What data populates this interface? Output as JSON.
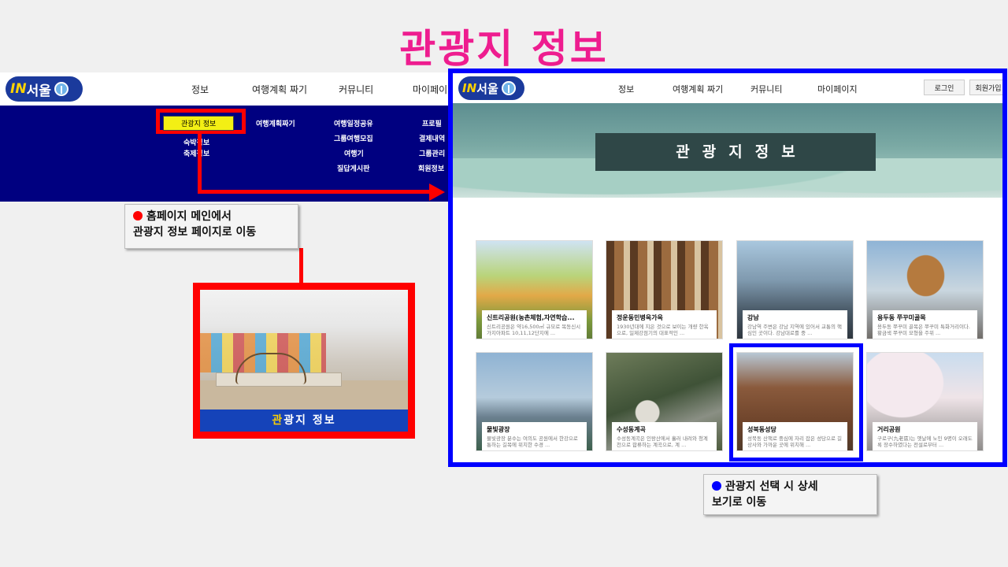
{
  "slide_title": "관광지 정보",
  "brand": {
    "prefix": "IN",
    "name": "서울"
  },
  "left_page": {
    "nav": [
      "정보",
      "여행계획 짜기",
      "커뮤니티",
      "마이페이지"
    ],
    "menu": {
      "col1": [
        "관광지 정보",
        "숙박정보",
        "축제정보"
      ],
      "col2": [
        "여행계획짜기"
      ],
      "col3": [
        "여행일정공유",
        "그룹여행모집",
        "여행기",
        "질답게시판"
      ],
      "col4": [
        "프로필",
        "결제내역",
        "그룹관리",
        "회원정보"
      ]
    },
    "highlighted_item": "관광지 정보"
  },
  "callout_left": {
    "line1": "홈페이지 메인에서",
    "line2": "관광지 정보 페이지로 이동"
  },
  "thumbnail_caption": {
    "first": "관",
    "rest": "광지 정보"
  },
  "right_page": {
    "nav": [
      "정보",
      "여행계획 짜기",
      "커뮤니티",
      "마이페이지"
    ],
    "login": "로그인",
    "signup": "회원가입",
    "hero_title": "관광지정보",
    "cards": [
      {
        "title": "신트리공원(농촌체험,자연학습...",
        "desc": "신트리공원은 약16,500㎡ 규모로 목동신시가지아파트 10,11,12단지에 ..."
      },
      {
        "title": "정운동민병옥가옥",
        "desc": "1930년대에 지은 것으로 보이는 개량 한옥으로, 일제강점기의 대표적인 ..."
      },
      {
        "title": "강남",
        "desc": "강남역 주변은 강남 지역에 있어서 교통의 핵심인 곳이다. 강남대로를 중 ..."
      },
      {
        "title": "용두동 쭈꾸미골목",
        "desc": "용두동 쭈꾸미 골목은 쭈꾸미 특화거리이다. 황금색 쭈꾸미 모형을 주위 ..."
      },
      {
        "title": "물빛광장",
        "desc": "물빛광장 분수는 여의도 공원에서 한강으로 통하는 길목에 위치한 수경 ..."
      },
      {
        "title": "수성동계곡",
        "desc": "수성동계곡은 인왕산에서 흘러 내려와 청계천으로 합류하는 계곡으로, 계 ..."
      },
      {
        "title": "성북동성당",
        "desc": "성북동 산책로 중심에 자리 잡은 성당으로 길상사와 가까운 곳에 위치해 ..."
      },
      {
        "title": "거리공원",
        "desc": "구로구(九老區)는 옛날에 노인 9명이 오래도록 장수하였다는 전설로부터 ..."
      }
    ]
  },
  "callout_right": {
    "line1": "관광지 선택 시 상세",
    "line2": "보기로 이동"
  },
  "colors": {
    "title_pink": "#ee1d8f",
    "menu_navy": "#000080",
    "highlight_red": "#ff0000",
    "frame_blue": "#0000ff"
  }
}
